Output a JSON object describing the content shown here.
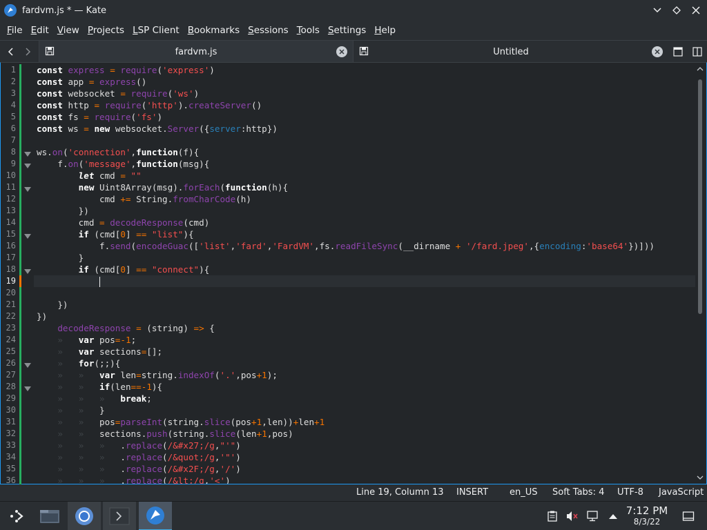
{
  "window": {
    "title": "fardvm.js * — Kate",
    "app_icon": "kate-icon",
    "controls": [
      "minimize-icon",
      "keep-above-icon",
      "close-icon"
    ]
  },
  "menu": {
    "items": [
      {
        "label": "File",
        "mnemonic": "F"
      },
      {
        "label": "Edit",
        "mnemonic": "E"
      },
      {
        "label": "View",
        "mnemonic": "V"
      },
      {
        "label": "Projects",
        "mnemonic": "P"
      },
      {
        "label": "LSP Client",
        "mnemonic": "L"
      },
      {
        "label": "Bookmarks",
        "mnemonic": "B"
      },
      {
        "label": "Sessions",
        "mnemonic": "S"
      },
      {
        "label": "Tools",
        "mnemonic": "T"
      },
      {
        "label": "Settings",
        "mnemonic": "S"
      },
      {
        "label": "Help",
        "mnemonic": "H"
      }
    ]
  },
  "tabs": [
    {
      "label": "fardvm.js",
      "active": true
    },
    {
      "label": "Untitled",
      "active": false
    }
  ],
  "editor": {
    "current_line": 19,
    "lines": [
      "const express = require('express')",
      "const app = express()",
      "const websocket = require('ws')",
      "const http = require('http').createServer()",
      "const fs = require('fs')",
      "const ws = new websocket.Server({server:http})",
      "",
      "ws.on('connection',function(f){",
      "    f.on('message',function(msg){",
      "        let cmd = \"\"",
      "        new Uint8Array(msg).forEach(function(h){",
      "            cmd += String.fromCharCode(h)",
      "        })",
      "        cmd = decodeResponse(cmd)",
      "        if (cmd[0] == \"list\"){",
      "            f.send(encodeGuac(['list','fard','FardVM',fs.readFileSync(__dirname + '/fard.jpeg',{encoding:'base64'})]))",
      "        }",
      "        if (cmd[0] == \"connect\"){",
      "",
      "",
      "    })",
      "})",
      "    decodeResponse = (string) => {",
      "        var pos=-1;",
      "        var sections=[];",
      "        for(;;){",
      "            var len=string.indexOf('.',pos+1);",
      "            if(len==-1){",
      "                break;",
      "            }",
      "            pos=parseInt(string.slice(pos+1,len))+len+1",
      "            sections.push(string.slice(len+1,pos)",
      "                .replace(/&#x27;/g,\"'\")",
      "                .replace(/&quot;/g,'\"')",
      "                .replace(/&#x2F;/g,'/')",
      "                .replace(/&lt;/g,'<')"
    ],
    "fold_lines": [
      8,
      9,
      11,
      15,
      18,
      26,
      28
    ]
  },
  "status": {
    "position": "Line 19, Column 13",
    "mode": "INSERT",
    "dictionary": "en_US",
    "indent": "Soft Tabs: 4",
    "encoding": "UTF-8",
    "language": "JavaScript"
  },
  "taskbar": {
    "launchers": [
      "app-launcher-icon",
      "file-manager-icon",
      "chromium-icon",
      "terminal-icon",
      "kate-icon"
    ],
    "tray": [
      "clipboard-icon",
      "volume-muted-icon",
      "network-icon",
      "tray-expand-icon"
    ],
    "time": "7:12 PM",
    "date": "8/3/22"
  },
  "colors": {
    "accent": "#1d99f3",
    "keyword": "#ffffff",
    "string": "#f44f4f",
    "function": "#8e44ad",
    "number": "#f67400",
    "background": "#232629"
  }
}
